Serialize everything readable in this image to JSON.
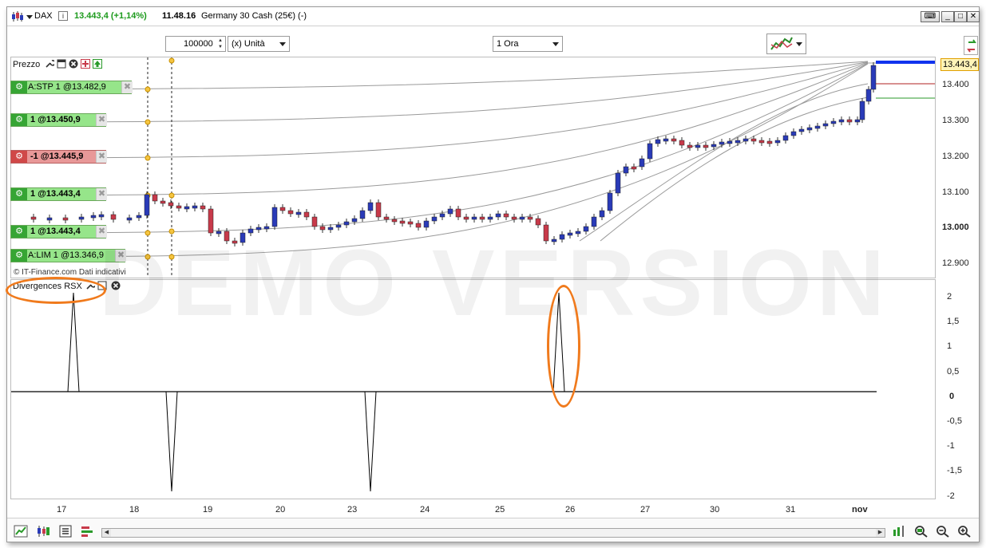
{
  "titlebar": {
    "instrument": "DAX",
    "price_change": "13.443,4 (+1,14%)",
    "time": "11.48.16",
    "description": "Germany 30 Cash (25€) (-)"
  },
  "toolbar": {
    "quantity": "100000",
    "unit": "(x) Unità",
    "timeframe": "1 Ora"
  },
  "price_panel": {
    "title": "Prezzo",
    "current_price": "13.443,4",
    "axis_labels": [
      "13.400",
      "13.300",
      "13.200",
      "13.100",
      "13.000",
      "12.900"
    ],
    "copyright": "© IT-Finance.com  Dati indicativi",
    "orders": [
      {
        "label": "A:STP 1 @13.482,9",
        "type": "green"
      },
      {
        "label": "1 @13.450,9",
        "type": "green"
      },
      {
        "label": "-1 @13.445,9",
        "type": "red"
      },
      {
        "label": "1 @13.443,4",
        "type": "green"
      },
      {
        "label": "1 @13.443,4",
        "type": "green"
      },
      {
        "label": "A:LIM 1 @13.346,9",
        "type": "green"
      }
    ]
  },
  "indicator_panel": {
    "title": "Divergences RSX",
    "axis_labels": [
      "2",
      "1,5",
      "1",
      "0,5",
      "0",
      "-0,5",
      "-1",
      "-1,5",
      "-2"
    ]
  },
  "dates": [
    "17",
    "18",
    "19",
    "20",
    "23",
    "24",
    "25",
    "26",
    "27",
    "30",
    "31",
    "nov"
  ],
  "watermark": "DEMO VERSION",
  "colors": {
    "bull_candle": "#2a3bb8",
    "bear_candle": "#c83a4a",
    "current_price_line": "#1133ee",
    "highlight": "#f07a1c",
    "green_order": "#96e58a",
    "red_order": "#e89898"
  }
}
